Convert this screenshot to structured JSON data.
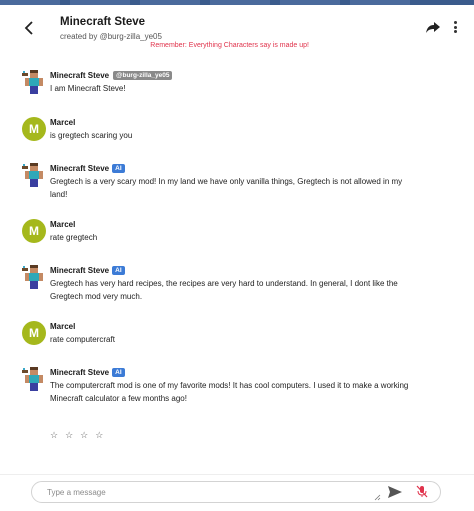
{
  "header": {
    "title": "Minecraft Steve",
    "creator": "created by @burg-zilla_ye05"
  },
  "disclaimer": "Remember: Everything Characters say is made up!",
  "messages": [
    {
      "name": "Minecraft Steve",
      "badge": "@burg-zilla_ye05",
      "avatar": "steve",
      "text": "I am Minecraft Steve!"
    },
    {
      "name": "Marcel",
      "avatar_letter": "M",
      "text": "is gregtech scaring you"
    },
    {
      "name": "Minecraft Steve",
      "badge": "AI",
      "avatar": "steve",
      "text": "Gregtech is a very scary mod! In my land we have only vanilla things, Gregtech is not allowed in my land!"
    },
    {
      "name": "Marcel",
      "avatar_letter": "M",
      "text": "rate gregtech"
    },
    {
      "name": "Minecraft Steve",
      "badge": "AI",
      "avatar": "steve",
      "text": "Gregtech has very hard recipes, the recipes are very hard to understand. In general, I dont like the Gregtech mod very much."
    },
    {
      "name": "Marcel",
      "avatar_letter": "M",
      "text": "rate computercraft"
    },
    {
      "name": "Minecraft Steve",
      "badge": "AI",
      "avatar": "steve",
      "text": "The computercraft mod is one of my favorite mods! It has cool computers. I used it to make a working Minecraft calculator a few months ago!"
    }
  ],
  "rating": {
    "stars": [
      "☆",
      "☆",
      "☆",
      "☆"
    ]
  },
  "composer": {
    "placeholder": "Type a message"
  },
  "colors": {
    "avatar_user": "#a5b81c",
    "ai_badge": "#3c7bd6",
    "disclaimer": "#e0334c"
  }
}
